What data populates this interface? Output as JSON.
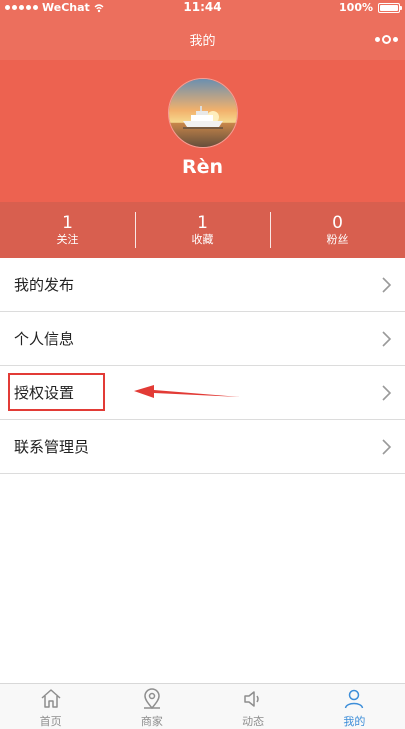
{
  "status_bar": {
    "carrier": "WeChat",
    "time": "11:44",
    "battery": "100%"
  },
  "nav": {
    "title": "我的"
  },
  "profile": {
    "username": "Rèn"
  },
  "stats": [
    {
      "value": "1",
      "label": "关注"
    },
    {
      "value": "1",
      "label": "收藏"
    },
    {
      "value": "0",
      "label": "粉丝"
    }
  ],
  "menu": [
    {
      "label": "我的发布"
    },
    {
      "label": "个人信息"
    },
    {
      "label": "授权设置"
    },
    {
      "label": "联系管理员"
    }
  ],
  "tabs": [
    {
      "label": "首页",
      "icon": "home-icon",
      "active": false
    },
    {
      "label": "商家",
      "icon": "location-pin-icon",
      "active": false
    },
    {
      "label": "动态",
      "icon": "speaker-icon",
      "active": false
    },
    {
      "label": "我的",
      "icon": "user-icon",
      "active": true
    }
  ],
  "colors": {
    "header": "#ec6f5d",
    "profile": "#ed6250",
    "stats": "#d85f4f",
    "tab_active": "#3d8ed9",
    "annotation": "#e23b36"
  }
}
